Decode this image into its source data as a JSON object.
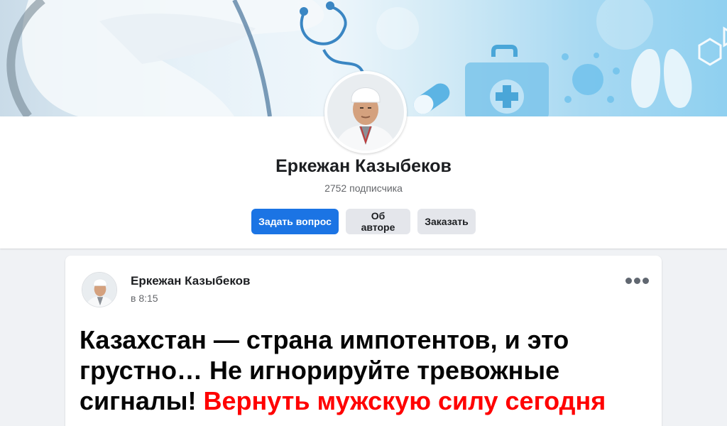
{
  "profile": {
    "name": "Еркежан Казыбеков",
    "subscribers": "2752 подписчика"
  },
  "actions": {
    "ask": "Задать вопрос",
    "about": "Об авторе",
    "order": "Заказать"
  },
  "post": {
    "author": "Еркежан Казыбеков",
    "time": "в 8:15",
    "headline_black": "Казахстан — страна импотентов, и это грустно… Не игнорируйте тревожные сигналы! ",
    "headline_red": "Вернуть мужскую силу сегодня"
  },
  "colors": {
    "primary": "#1b74e4",
    "secondary_bg": "#e4e6eb",
    "link_red": "#ff0000",
    "page_bg": "#f0f2f5"
  },
  "icons": [
    "stethoscope-icon",
    "medical-kit-icon",
    "lungs-icon",
    "molecule-icon",
    "more-options-icon"
  ]
}
